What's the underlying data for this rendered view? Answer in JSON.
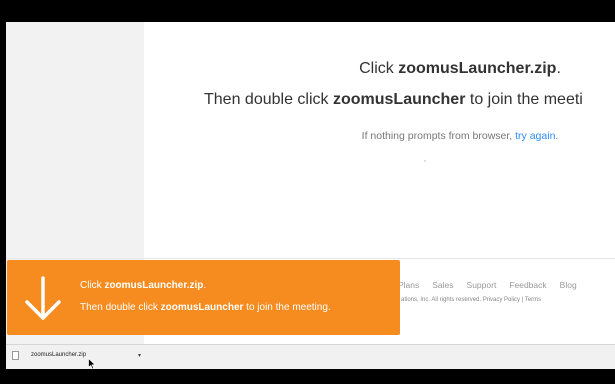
{
  "page": {
    "line1_pre": "Click ",
    "line1_bold": "zoomusLauncher.zip",
    "line1_post": ".",
    "line2_pre": "Then double click ",
    "line2_bold": "zoomusLauncher",
    "line2_post": " to join the meeti",
    "line3_pre": "If nothing prompts from browser, ",
    "line3_link": "try again",
    "line3_post": "."
  },
  "footer": {
    "links": [
      "Plans",
      "Sales",
      "Support",
      "Feedback",
      "Blog"
    ],
    "copyright": "ations, Inc. All rights reserved. Privacy Policy | Terms"
  },
  "banner": {
    "line1_pre": "Click ",
    "line1_bold": "zoomusLauncher.zip",
    "line1_post": ".",
    "line2_pre": "Then double click ",
    "line2_bold": "zoomusLauncher",
    "line2_post": " to join the meeting.",
    "icon": "download-arrow-icon",
    "color": "#f68b1f"
  },
  "download_shelf": {
    "filename": "zoomusLauncher.zip",
    "menu_icon": "chevron-down-icon"
  }
}
